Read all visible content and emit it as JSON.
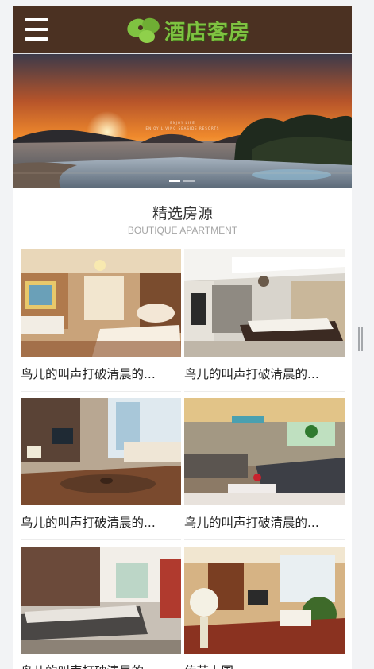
{
  "header": {
    "menu_icon": "hamburger-menu-icon",
    "logo_icon": "green-leaf-logo-icon",
    "logo_text": "酒店客房",
    "background_color": "#4b3122",
    "logo_color": "#7fc241"
  },
  "banner": {
    "caption_line1": "ENJOY LIFE",
    "caption_line2": "ENJOY LIVING SEASIDE RESORTS",
    "slides_count": 2,
    "active_slide": 1
  },
  "section": {
    "title": "精选房源",
    "subtitle": "BOUTIQUE APARTMENT"
  },
  "rooms": [
    {
      "title": "鸟儿的叫声打破清晨的..."
    },
    {
      "title": "鸟儿的叫声打破清晨的..."
    },
    {
      "title": "鸟儿的叫声打破清晨的..."
    },
    {
      "title": "鸟儿的叫声打破清晨的..."
    },
    {
      "title": "鸟儿的叫声打破清晨的..."
    },
    {
      "title": "传芸上国"
    }
  ]
}
